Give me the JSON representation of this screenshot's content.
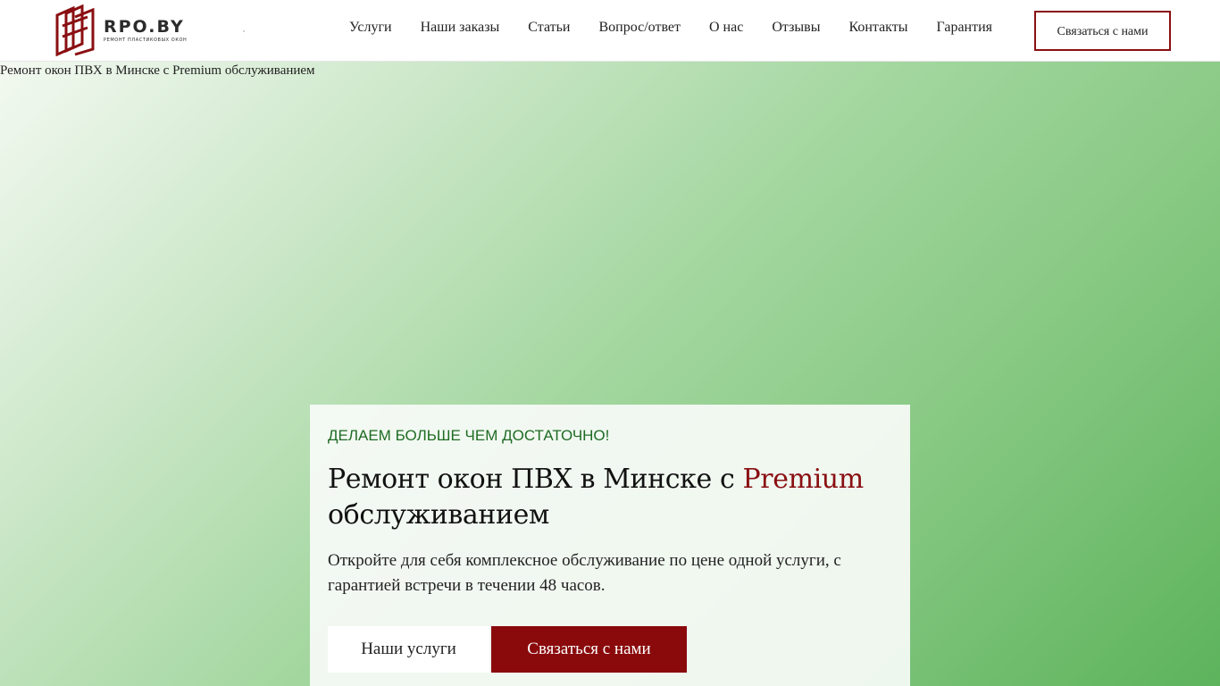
{
  "brand": {
    "name": "RPO.BY",
    "tagline": "Ремонт пластиковых окон",
    "accent_color": "#8a0f12",
    "logo_icon": "window-frame-logo"
  },
  "nav": {
    "items": [
      {
        "label": "Услуги"
      },
      {
        "label": "Наши заказы"
      },
      {
        "label": "Статьи"
      },
      {
        "label": "Вопрос/ответ"
      },
      {
        "label": "О нас"
      },
      {
        "label": "Отзывы"
      },
      {
        "label": "Контакты"
      },
      {
        "label": "Гарантия"
      }
    ],
    "cta_label": "Связаться с нами"
  },
  "hero": {
    "image_alt": "Ремонт окон ПВХ в Минске с Premium обслуживанием",
    "eyebrow": "ДЕЛАЕМ БОЛЬШЕ ЧЕМ ДОСТАТОЧНО!",
    "title_main": "Ремонт окон ПВХ в Минске с ",
    "title_accent": "Premium",
    "title_end": " обслуживанием",
    "description": "Откройте для себя комплексное обслуживание по цене одной услуги, с гарантией встречи в течении 48 часов.",
    "btn_services": "Наши услуги",
    "btn_contact": "Связаться с нами",
    "eyebrow_color": "#1f6b24",
    "button_color": "#8a0a0c"
  }
}
